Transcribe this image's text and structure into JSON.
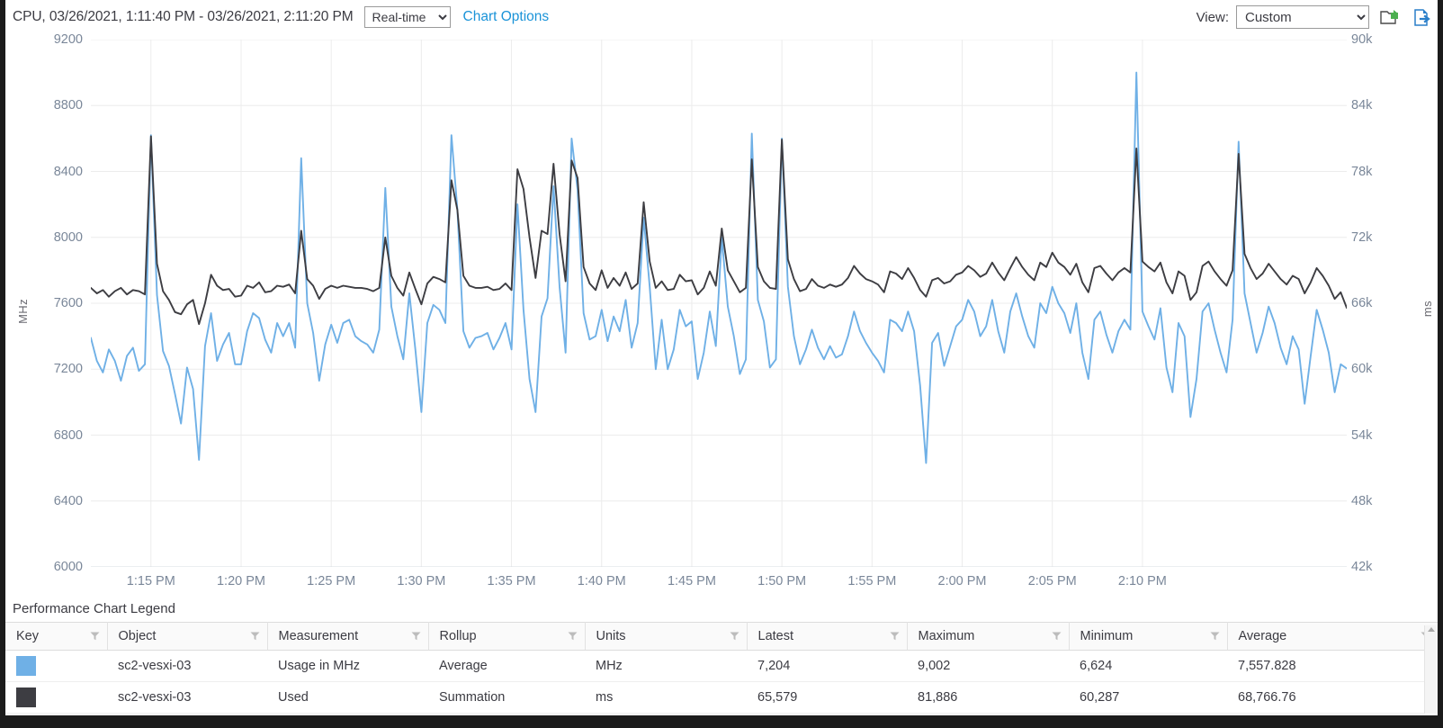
{
  "toolbar": {
    "chart_title": "CPU, 03/26/2021, 1:11:40 PM - 03/26/2021, 2:11:20 PM",
    "interval_value": "Real-time",
    "interval_options": [
      "Real-time"
    ],
    "chart_options_link": "Chart Options",
    "view_label": "View:",
    "view_value": "Custom",
    "view_options": [
      "Custom"
    ],
    "save_chart_icon": "save-chart-icon",
    "export_icon": "export-icon"
  },
  "legend": {
    "title": "Performance Chart Legend",
    "columns": [
      "Key",
      "Object",
      "Measurement",
      "Rollup",
      "Units",
      "Latest",
      "Maximum",
      "Minimum",
      "Average"
    ],
    "rows": [
      {
        "key_color": "#6fb0e6",
        "object": "sc2-vesxi-03",
        "measurement": "Usage in MHz",
        "rollup": "Average",
        "units": "MHz",
        "latest": "7,204",
        "maximum": "9,002",
        "minimum": "6,624",
        "average": "7,557.828"
      },
      {
        "key_color": "#3d3d42",
        "object": "sc2-vesxi-03",
        "measurement": "Used",
        "rollup": "Summation",
        "units": "ms",
        "latest": "65,579",
        "maximum": "81,886",
        "minimum": "60,287",
        "average": "68,766.76"
      }
    ]
  },
  "chart_data": {
    "type": "line",
    "title": "CPU, 03/26/2021, 1:11:40 PM - 03/26/2021, 2:11:20 PM",
    "grid": true,
    "legend_position": "bottom-table",
    "xlabel": "",
    "x_tick_labels": [
      "1:15 PM",
      "1:20 PM",
      "1:25 PM",
      "1:30 PM",
      "1:35 PM",
      "1:40 PM",
      "1:45 PM",
      "1:50 PM",
      "1:55 PM",
      "2:00 PM",
      "2:05 PM",
      "2:10 PM"
    ],
    "x_start": "1:11:40 PM",
    "x_end": "2:11:20 PM",
    "x_sample_interval_seconds": 20,
    "axes": [
      {
        "side": "left",
        "label": "MHz",
        "ylim": [
          6000,
          9200
        ],
        "ticks": [
          6000,
          6400,
          6800,
          7200,
          7600,
          8000,
          8400,
          8800,
          9200
        ],
        "tick_labels": [
          "6000",
          "6400",
          "6800",
          "7200",
          "7600",
          "8000",
          "8400",
          "8800",
          "9200"
        ]
      },
      {
        "side": "right",
        "label": "ms",
        "ylim": [
          42000,
          90000
        ],
        "ticks": [
          42000,
          48000,
          54000,
          60000,
          66000,
          72000,
          78000,
          84000,
          90000
        ],
        "tick_labels": [
          "42k",
          "48k",
          "54k",
          "60k",
          "66k",
          "72k",
          "78k",
          "84k",
          "90k"
        ]
      }
    ],
    "series": [
      {
        "name": "Usage in MHz",
        "object": "sc2-vesxi-03",
        "rollup": "Average",
        "units": "MHz",
        "axis": "left",
        "color": "#6fb0e6",
        "latest": 7204,
        "maximum": 9002,
        "minimum": 6624,
        "average": 7557.828,
        "values": [
          7390,
          7250,
          7180,
          7320,
          7250,
          7130,
          7280,
          7330,
          7190,
          7230,
          8620,
          7650,
          7310,
          7220,
          7050,
          6870,
          7210,
          7080,
          6650,
          7340,
          7540,
          7250,
          7350,
          7420,
          7230,
          7230,
          7430,
          7540,
          7510,
          7380,
          7300,
          7480,
          7400,
          7480,
          7330,
          8480,
          7600,
          7420,
          7130,
          7350,
          7470,
          7360,
          7480,
          7500,
          7400,
          7370,
          7350,
          7300,
          7440,
          8300,
          7580,
          7400,
          7260,
          7660,
          7320,
          6940,
          7480,
          7590,
          7560,
          7480,
          8620,
          8170,
          7430,
          7330,
          7390,
          7400,
          7420,
          7320,
          7390,
          7480,
          7320,
          8200,
          7560,
          7140,
          6940,
          7520,
          7630,
          8310,
          7700,
          7300,
          8600,
          8290,
          7540,
          7380,
          7400,
          7560,
          7370,
          7520,
          7430,
          7620,
          7330,
          7480,
          8120,
          7700,
          7200,
          7500,
          7200,
          7320,
          7560,
          7460,
          7490,
          7140,
          7300,
          7550,
          7340,
          8000,
          7580,
          7400,
          7170,
          7260,
          8630,
          7620,
          7490,
          7210,
          7260,
          8600,
          7700,
          7400,
          7230,
          7320,
          7440,
          7330,
          7260,
          7340,
          7270,
          7290,
          7400,
          7550,
          7430,
          7360,
          7300,
          7250,
          7180,
          7500,
          7480,
          7430,
          7550,
          7430,
          7100,
          6630,
          7360,
          7420,
          7220,
          7340,
          7460,
          7500,
          7620,
          7550,
          7400,
          7460,
          7620,
          7430,
          7300,
          7550,
          7660,
          7520,
          7400,
          7330,
          7600,
          7540,
          7700,
          7600,
          7540,
          7420,
          7600,
          7300,
          7140,
          7500,
          7550,
          7410,
          7300,
          7430,
          7500,
          7440,
          9000,
          7550,
          7460,
          7380,
          7570,
          7210,
          7060,
          7480,
          7400,
          6910,
          7140,
          7550,
          7600,
          7440,
          7300,
          7180,
          7500,
          8580,
          7660,
          7480,
          7300,
          7420,
          7580,
          7480,
          7330,
          7230,
          7400,
          7320,
          6990,
          7280,
          7560,
          7440,
          7300,
          7060,
          7230,
          7204
        ]
      },
      {
        "name": "Used",
        "object": "sc2-vesxi-03",
        "rollup": "Summation",
        "units": "ms",
        "axis": "right",
        "color": "#3d3d42",
        "latest": 65579,
        "maximum": 81886,
        "minimum": 60287,
        "average": 68766.76,
        "values": [
          67400,
          66900,
          67200,
          66600,
          67100,
          67400,
          66800,
          67200,
          67100,
          66800,
          81200,
          69600,
          67100,
          66300,
          65200,
          65000,
          65900,
          66300,
          64100,
          66000,
          68600,
          67600,
          67200,
          67300,
          66600,
          66700,
          67600,
          67400,
          67900,
          67000,
          67100,
          67600,
          67500,
          67700,
          66900,
          72600,
          68200,
          67600,
          66400,
          67300,
          67600,
          67400,
          67600,
          67500,
          67400,
          67400,
          67300,
          67100,
          67400,
          72000,
          68500,
          67400,
          66700,
          68800,
          67300,
          65900,
          67800,
          68400,
          68200,
          67900,
          77200,
          74500,
          68500,
          67600,
          67400,
          67400,
          67500,
          67200,
          67300,
          67800,
          67200,
          78200,
          76400,
          72000,
          68300,
          72600,
          72300,
          78700,
          72300,
          68000,
          79000,
          77400,
          69300,
          67800,
          67200,
          69000,
          67400,
          68300,
          67600,
          68800,
          67300,
          67800,
          75200,
          69800,
          67400,
          68000,
          67200,
          67300,
          68600,
          68000,
          68100,
          66800,
          67400,
          68900,
          67600,
          72800,
          69000,
          68000,
          67000,
          67400,
          79100,
          69300,
          68000,
          67400,
          67300,
          80900,
          70000,
          68200,
          67100,
          67300,
          68200,
          67600,
          67400,
          67700,
          67500,
          67700,
          68300,
          69400,
          68700,
          68200,
          68000,
          67700,
          67000,
          68900,
          68700,
          68200,
          69200,
          68300,
          67200,
          66600,
          68100,
          68300,
          67800,
          68000,
          68600,
          68800,
          69400,
          69000,
          68400,
          68700,
          69700,
          68800,
          68100,
          69200,
          70200,
          69300,
          68600,
          68100,
          69700,
          69300,
          70600,
          69700,
          69300,
          68600,
          69600,
          67900,
          67000,
          69200,
          69400,
          68700,
          68100,
          68800,
          69200,
          68800,
          80100,
          69800,
          69300,
          68900,
          69700,
          67900,
          66900,
          68900,
          68500,
          66300,
          67000,
          69400,
          69800,
          68900,
          68200,
          67600,
          69000,
          79600,
          70500,
          69200,
          68200,
          68700,
          69600,
          68900,
          68200,
          67700,
          68500,
          68200,
          66900,
          67900,
          69200,
          68500,
          67600,
          66400,
          67000,
          65579
        ]
      }
    ]
  }
}
